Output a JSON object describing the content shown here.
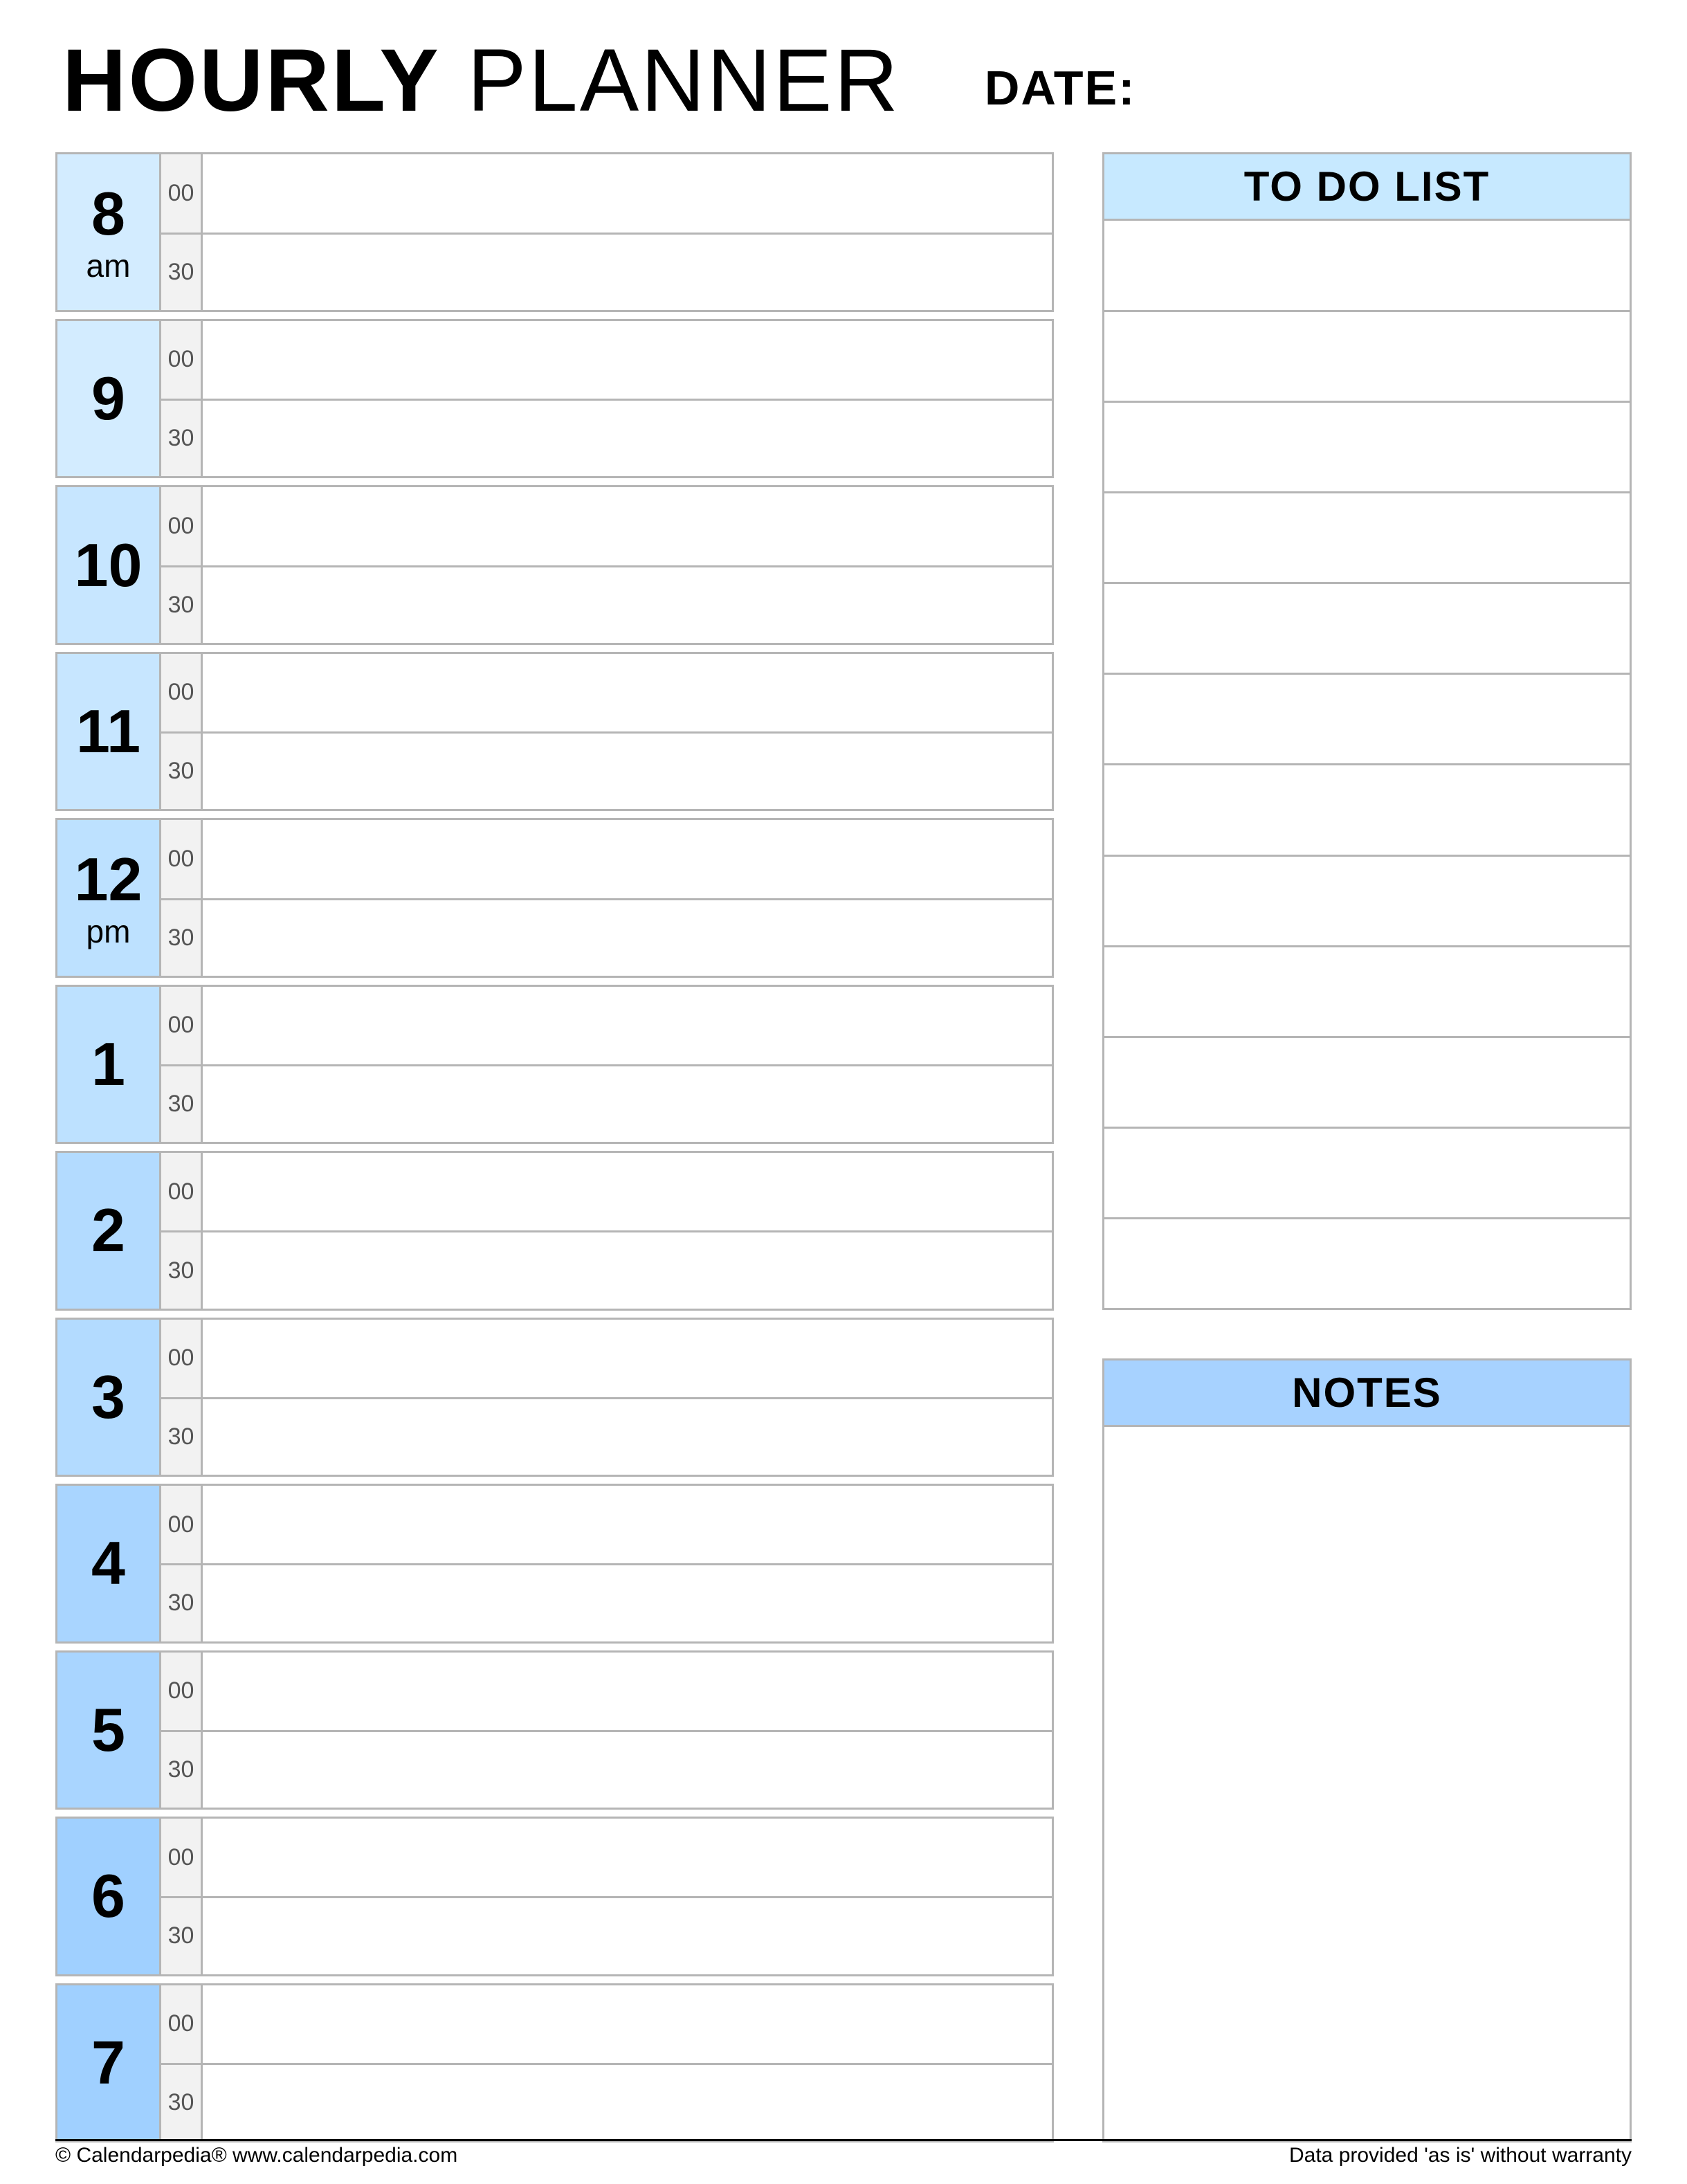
{
  "title_bold": "HOURLY",
  "title_light": " PLANNER",
  "date_label": "DATE:",
  "hours": [
    {
      "num": "8",
      "ampm": "am",
      "shade": "#d3ecff"
    },
    {
      "num": "9",
      "ampm": "",
      "shade": "#d3ecff"
    },
    {
      "num": "10",
      "ampm": "",
      "shade": "#c7e6ff"
    },
    {
      "num": "11",
      "ampm": "",
      "shade": "#c7e6ff"
    },
    {
      "num": "12",
      "ampm": "pm",
      "shade": "#bde1ff"
    },
    {
      "num": "1",
      "ampm": "",
      "shade": "#bde1ff"
    },
    {
      "num": "2",
      "ampm": "",
      "shade": "#b3dbff"
    },
    {
      "num": "3",
      "ampm": "",
      "shade": "#b3dbff"
    },
    {
      "num": "4",
      "ampm": "",
      "shade": "#a9d5ff"
    },
    {
      "num": "5",
      "ampm": "",
      "shade": "#a9d5ff"
    },
    {
      "num": "6",
      "ampm": "",
      "shade": "#a0d0ff"
    },
    {
      "num": "7",
      "ampm": "",
      "shade": "#a0d0ff"
    }
  ],
  "minute_labels": [
    "00",
    "30"
  ],
  "todo_header": "TO DO LIST",
  "todo_lines": 12,
  "notes_header": "NOTES",
  "footer_left": "© Calendarpedia®   www.calendarpedia.com",
  "footer_right": "Data provided 'as is' without warranty"
}
